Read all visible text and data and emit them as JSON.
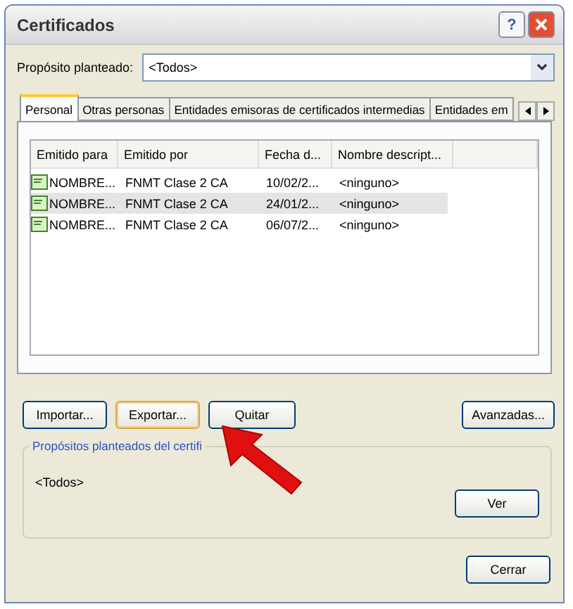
{
  "window": {
    "title": "Certificados",
    "help_button": "?"
  },
  "purpose": {
    "label": "Propósito planteado:",
    "value": "<Todos>"
  },
  "tabs": [
    {
      "label": "Personal",
      "selected": true
    },
    {
      "label": "Otras personas",
      "selected": false
    },
    {
      "label": "Entidades emisoras de certificados intermedias",
      "selected": false
    },
    {
      "label": "Entidades em",
      "selected": false
    }
  ],
  "table": {
    "columns": [
      "Emitido para",
      "Emitido por",
      "Fecha d...",
      "Nombre descript..."
    ],
    "rows": [
      {
        "cells": [
          "NOMBRE...",
          "FNMT Clase 2 CA",
          "10/02/2...",
          "<ninguno>"
        ],
        "selected": false
      },
      {
        "cells": [
          "NOMBRE...",
          "FNMT Clase 2 CA",
          "24/01/2...",
          "<ninguno>"
        ],
        "selected": true
      },
      {
        "cells": [
          "NOMBRE...",
          "FNMT Clase 2 CA",
          "06/07/2...",
          "<ninguno>"
        ],
        "selected": false
      }
    ]
  },
  "actions": [
    {
      "label": "Importar...",
      "focused": false
    },
    {
      "label": "Exportar...",
      "focused": true
    },
    {
      "label": "Quitar",
      "focused": false
    }
  ],
  "advanced_button": "Avanzadas...",
  "purposes_group": {
    "title": "Propósitos planteados del certifi",
    "value": "<Todos>",
    "button": "Ver"
  },
  "close_button": "Cerrar"
}
